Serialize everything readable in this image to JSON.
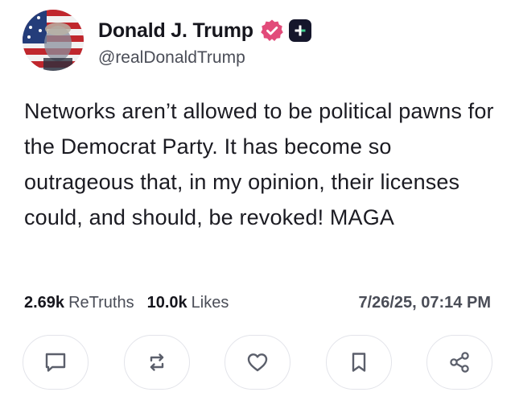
{
  "post": {
    "author": {
      "display_name": "Donald J. Trump",
      "handle": "@realDonaldTrump",
      "avatar_icon": "flag-portrait-avatar",
      "verified_icon": "verified-badge-icon",
      "verified_color": "#e24b7a",
      "plus_badge_icon": "plus-badge-icon"
    },
    "text": "Networks aren’t allowed to be political pawns for the Democrat Party. It has become so outrageous that, in my opinion, their licenses could, and should, be revoked! MAGA",
    "stats": {
      "retruths_count": "2.69k",
      "retruths_label": "ReTruths",
      "likes_count": "10.0k",
      "likes_label": "Likes",
      "timestamp": "7/26/25, 07:14 PM"
    },
    "actions": [
      {
        "icon": "comment-icon"
      },
      {
        "icon": "retruth-icon"
      },
      {
        "icon": "heart-icon"
      },
      {
        "icon": "bookmark-icon"
      },
      {
        "icon": "share-icon"
      }
    ]
  }
}
